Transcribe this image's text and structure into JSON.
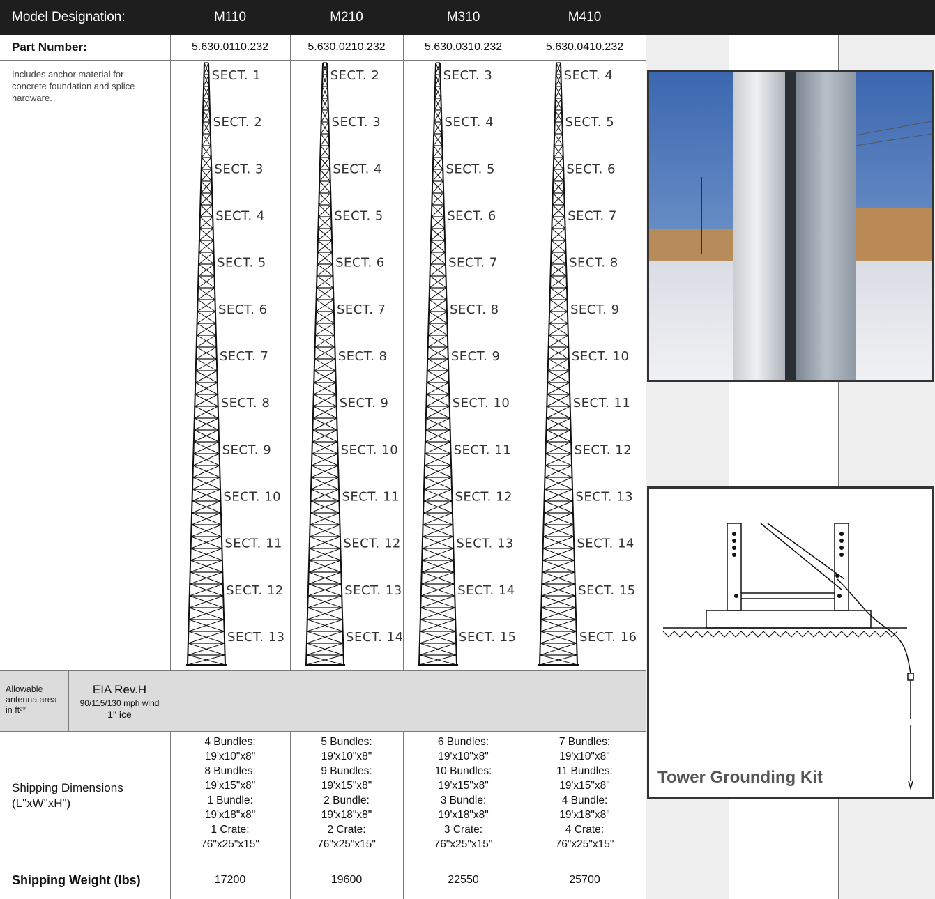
{
  "header": {
    "model_label": "Model Designation:",
    "models": [
      "M110",
      "M210",
      "M310",
      "M410"
    ]
  },
  "part_row": {
    "label": "Part Number:",
    "values": [
      "5.630.0110.232",
      "5.630.0210.232",
      "5.630.0310.232",
      "5.630.0410.232"
    ]
  },
  "note": "Includes anchor material for concrete foundation and splice hardware.",
  "towers": [
    {
      "sections": [
        "SECT. 1",
        "SECT. 2",
        "SECT. 3",
        "SECT. 4",
        "SECT. 5",
        "SECT. 6",
        "SECT. 7",
        "SECT. 8",
        "SECT. 9",
        "SECT. 10",
        "SECT. 11",
        "SECT. 12",
        "SECT. 13"
      ]
    },
    {
      "sections": [
        "SECT. 2",
        "SECT. 3",
        "SECT. 4",
        "SECT. 5",
        "SECT. 6",
        "SECT. 7",
        "SECT. 8",
        "SECT. 9",
        "SECT. 10",
        "SECT. 11",
        "SECT. 12",
        "SECT. 13",
        "SECT. 14"
      ]
    },
    {
      "sections": [
        "SECT. 3",
        "SECT. 4",
        "SECT. 5",
        "SECT. 6",
        "SECT. 7",
        "SECT. 8",
        "SECT. 9",
        "SECT. 10",
        "SECT. 11",
        "SECT. 12",
        "SECT. 13",
        "SECT. 14",
        "SECT. 15"
      ]
    },
    {
      "sections": [
        "SECT. 4",
        "SECT. 5",
        "SECT. 6",
        "SECT. 7",
        "SECT. 8",
        "SECT. 9",
        "SECT. 10",
        "SECT. 11",
        "SECT. 12",
        "SECT. 13",
        "SECT. 14",
        "SECT. 15",
        "SECT. 16"
      ]
    }
  ],
  "antenna_row": {
    "label": "Allowable antenna area in ft²*",
    "standard": "EIA Rev.H",
    "wind": "90/115/130 mph wind",
    "ice": "1\" ice"
  },
  "shipping_dims": {
    "label": "Shipping Dimensions (L\"xW\"xH\")",
    "values": [
      [
        "4 Bundles:",
        "19'x10\"x8\"",
        "8 Bundles:",
        "19'x15\"x8\"",
        "1 Bundle:",
        "19'x18\"x8\"",
        "1 Crate:",
        "76\"x25\"x15\""
      ],
      [
        "5 Bundles:",
        "19'x10\"x8\"",
        "9 Bundles:",
        "19'x15\"x8\"",
        "2 Bundle:",
        "19'x18\"x8\"",
        "2 Crate:",
        "76\"x25\"x15\""
      ],
      [
        "6 Bundles:",
        "19'x10\"x8\"",
        "10 Bundles:",
        "19'x15\"x8\"",
        "3 Bundle:",
        "19'x18\"x8\"",
        "3 Crate:",
        "76\"x25\"x15\""
      ],
      [
        "7 Bundles:",
        "19'x10\"x8\"",
        "11 Bundles:",
        "19'x15\"x8\"",
        "4 Bundle:",
        "19'x18\"x8\"",
        "4 Crate:",
        "76\"x25\"x15\""
      ]
    ]
  },
  "shipping_weight": {
    "label": "Shipping Weight (lbs)",
    "values": [
      "17200",
      "19600",
      "22550",
      "25700"
    ]
  },
  "grounding_kit": {
    "caption": "Tower Grounding Kit"
  }
}
